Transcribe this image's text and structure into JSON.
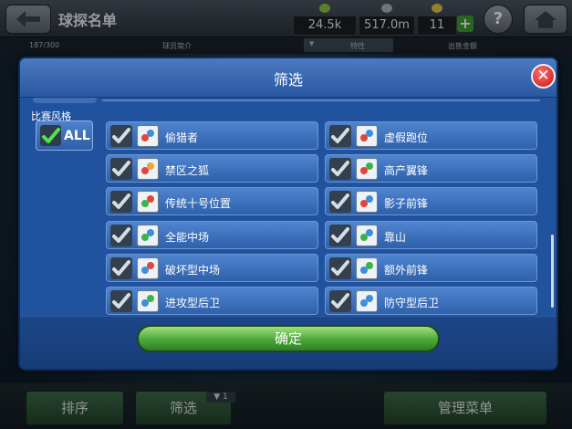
{
  "header": {
    "title": "球探名单",
    "stat1": "24.5k",
    "stat2": "517.0m",
    "stat3": "11",
    "plus": "+",
    "help": "?"
  },
  "subbar": {
    "count": "187/300",
    "col_intro": "球员简介",
    "col_trait": "特性",
    "col_fee": "出售金额"
  },
  "bottom": {
    "sort_label": "排序",
    "filter_label": "筛选",
    "filter_count": "1",
    "manage_label": "管理菜单"
  },
  "dialog": {
    "title": "筛选",
    "close": "✕",
    "section_label": "比赛风格",
    "all_label": "ALL",
    "confirm_label": "确定",
    "options": [
      {
        "label": "偷猎者",
        "checked": true,
        "icon": "poacher-icon"
      },
      {
        "label": "虚假跑位",
        "checked": true,
        "icon": "dummy-runner-icon"
      },
      {
        "label": "禁区之狐",
        "checked": true,
        "icon": "fox-in-box-icon"
      },
      {
        "label": "高产翼锋",
        "checked": true,
        "icon": "prolific-winger-icon"
      },
      {
        "label": "传统十号位置",
        "checked": true,
        "icon": "classic-no10-icon"
      },
      {
        "label": "影子前锋",
        "checked": true,
        "icon": "shadow-striker-icon"
      },
      {
        "label": "全能中场",
        "checked": true,
        "icon": "box-to-box-icon"
      },
      {
        "label": "靠山",
        "checked": true,
        "icon": "target-man-icon"
      },
      {
        "label": "破坏型中场",
        "checked": true,
        "icon": "destroyer-icon"
      },
      {
        "label": "额外前锋",
        "checked": true,
        "icon": "extra-frontman-icon"
      },
      {
        "label": "进攻型后卫",
        "checked": true,
        "icon": "offensive-fullback-icon"
      },
      {
        "label": "防守型后卫",
        "checked": true,
        "icon": "defensive-fullback-icon"
      }
    ]
  },
  "colors": {
    "dialog_bg": "#21529e",
    "option_bg": "#3f72bd",
    "confirm_green": "#4aa83a",
    "close_red": "#c31414"
  }
}
